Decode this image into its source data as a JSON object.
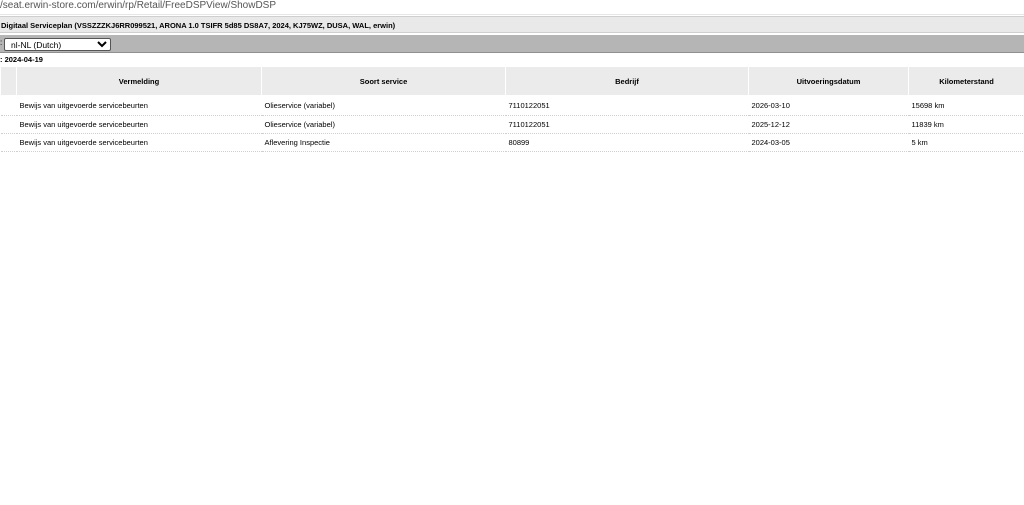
{
  "browser": {
    "url": "/seat.erwin-store.com/erwin/rp/Retail/FreeDSPView/ShowDSP"
  },
  "header": {
    "title": "Digitaal Serviceplan (VSSZZZKJ6RR099521, ARONA 1.0 TSIFR 5d85 DS8A7, 2024, KJ75WZ, DUSA, WAL, erwin)",
    "language_prefix": ":",
    "language_selected": "nl-NL (Dutch)",
    "date_line": ": 2024-04-19"
  },
  "table": {
    "columns": [
      "Vermelding",
      "Soort service",
      "Bedrijf",
      "Uitvoeringsdatum",
      "Kilometerstand"
    ],
    "rows": [
      [
        "Bewijs van uitgevoerde servicebeurten",
        "Olieservice (variabel)",
        "7110122051",
        "2026-03-10",
        "15698 km"
      ],
      [
        "Bewijs van uitgevoerde servicebeurten",
        "Olieservice (variabel)",
        "7110122051",
        "2025-12-12",
        "11839 km"
      ],
      [
        "Bewijs van uitgevoerde servicebeurten",
        "Aflevering Inspectie",
        "80899",
        "2024-03-05",
        "5 km"
      ]
    ]
  }
}
